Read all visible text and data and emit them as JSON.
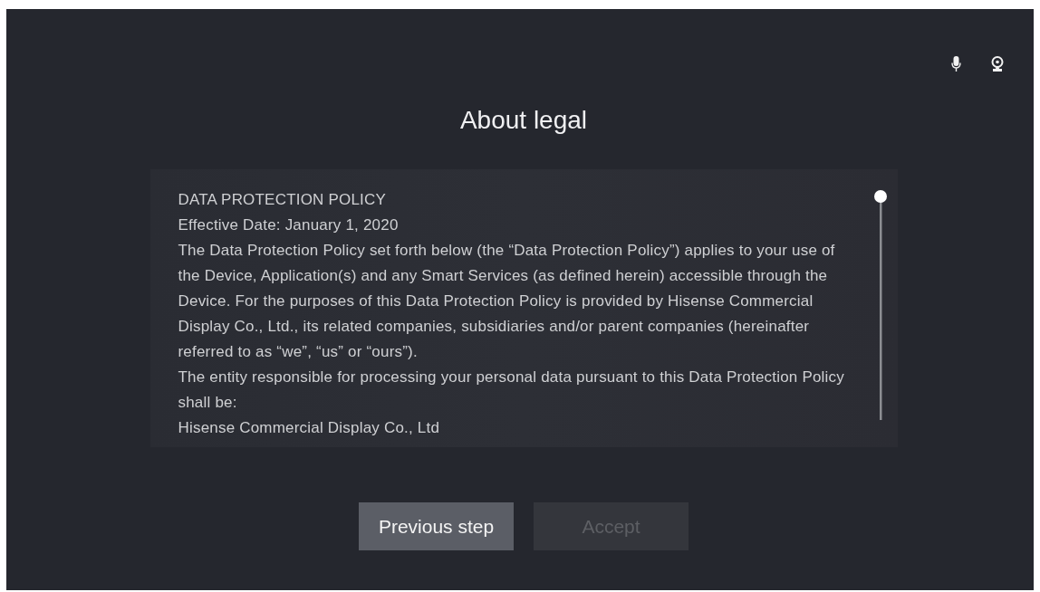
{
  "title": "About legal",
  "document": {
    "paragraphs": [
      "DATA PROTECTION POLICY",
      "Effective Date: January 1, 2020",
      "The Data Protection Policy set forth below (the “Data Protection Policy”) applies to your use of the Device, Application(s) and any Smart Services (as defined herein) accessible through the Device. For the purposes of this Data Protection Policy is provided by Hisense Commercial Display Co., Ltd., its related companies, subsidiaries and/or parent companies (hereinafter referred to as “we”, “us” or “ours”).",
      "The entity responsible for processing your personal data pursuant to this Data Protection Policy shall be:",
      "Hisense Commercial Display Co., Ltd"
    ]
  },
  "buttons": [
    {
      "label": "Previous step",
      "disabled": false
    },
    {
      "label": "Accept",
      "disabled": true
    }
  ]
}
